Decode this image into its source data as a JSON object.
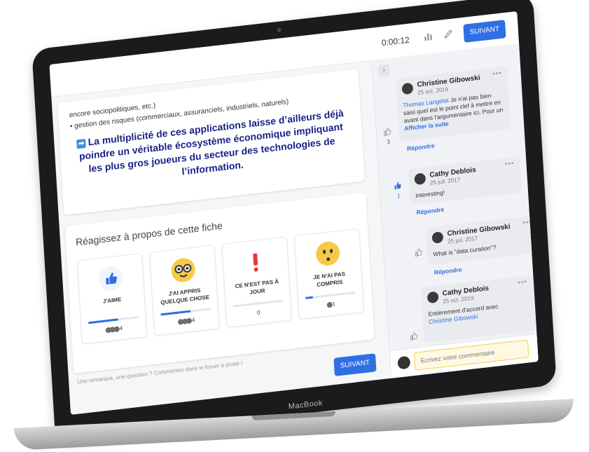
{
  "header": {
    "timer": "0:00:12",
    "next_label": "SUIVANT"
  },
  "content": {
    "line1": "encore sociopolitiques, etc.)",
    "line2": "gestion des risques (commerciaux, assuranciels, industriels, naturels)",
    "highlight": "La multiplicité de ces applications laisse d’ailleurs déjà poindre un véritable écosystème économique impliquant les plus gros joueurs du secteur des technologies de l’information."
  },
  "reactions": {
    "title": "Réagissez à propos de cette fiche",
    "items": [
      {
        "label": "J'AIME",
        "count": "4",
        "icon": "thumbs-up-icon",
        "fill": 0.6
      },
      {
        "label": "J'AI APPRIS QUELQUE CHOSE",
        "count": "4",
        "icon": "nerd-emoji-icon",
        "fill": 0.6
      },
      {
        "label": "CE N'EST PAS À JOUR",
        "count": "0",
        "icon": "exclamation-icon",
        "fill": 0.0
      },
      {
        "label": "JE N'AI PAS COMPRIS",
        "count": "1",
        "icon": "confused-emoji-icon",
        "fill": 0.15
      }
    ],
    "footer_hint": "Une remarque, une question ? Commentez dans le forum à droite !",
    "next_label": "SUIVANT"
  },
  "comments": [
    {
      "author": "Christine Gibowski",
      "date": "25 oct. 2019",
      "mention": "Thomas Langelot",
      "body": " Je n'ai pas bien saisi quel est le point clef à mettre en avant dans l'argumentaire ici. Pour un",
      "more": "Afficher la suite",
      "likes": "3",
      "reply": "Répondre"
    },
    {
      "author": "Cathy Deblois",
      "date": "25 juil. 2017",
      "body": "Interesting!",
      "likes": "1",
      "reply": "Répondre"
    },
    {
      "author": "Christine Gibowski",
      "date": "25 juil. 2017",
      "body": "What is \"data curation\"?",
      "reply": "Répondre"
    },
    {
      "author": "Cathy Deblois",
      "date": "25 oct. 2019",
      "body": "Entièrement d'accord avec",
      "mention": "Christine Gibowski"
    }
  ],
  "comment_input": {
    "placeholder": "Ecrivez votre commentaire"
  },
  "device": {
    "brand": "MacBook"
  },
  "colors": {
    "accent": "#2f6fe4",
    "highlight_text": "#1a1f86",
    "input_border": "#f4cc4c"
  }
}
